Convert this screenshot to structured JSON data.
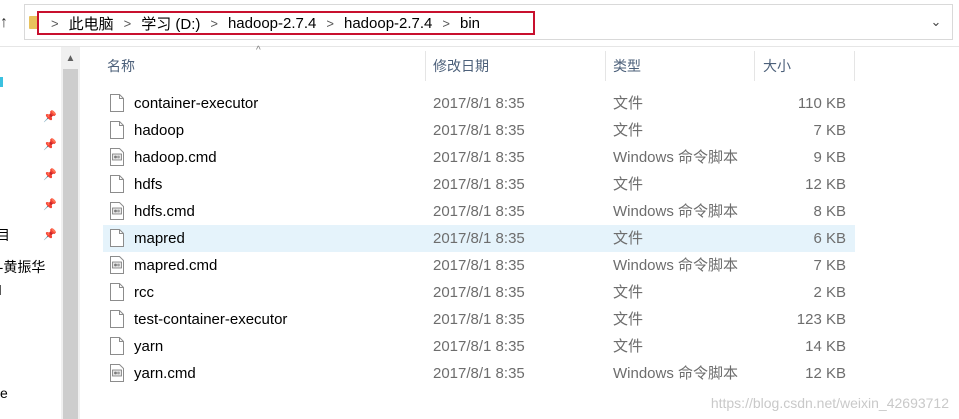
{
  "address": {
    "breadcrumbs": [
      "此电脑",
      "学习 (D:)",
      "hadoop-2.7.4",
      "hadoop-2.7.4",
      "bin"
    ]
  },
  "nav": {
    "partial_items": [
      "目",
      "--黄振华",
      "e"
    ]
  },
  "columns": {
    "name": "名称",
    "date": "修改日期",
    "type": "类型",
    "size": "大小"
  },
  "files": [
    {
      "name": "container-executor",
      "date": "2017/8/1 8:35",
      "type": "文件",
      "size": "110 KB",
      "icon": "file-icon"
    },
    {
      "name": "hadoop",
      "date": "2017/8/1 8:35",
      "type": "文件",
      "size": "7 KB",
      "icon": "file-icon"
    },
    {
      "name": "hadoop.cmd",
      "date": "2017/8/1 8:35",
      "type": "Windows 命令脚本",
      "size": "9 KB",
      "icon": "script-file-icon"
    },
    {
      "name": "hdfs",
      "date": "2017/8/1 8:35",
      "type": "文件",
      "size": "12 KB",
      "icon": "file-icon"
    },
    {
      "name": "hdfs.cmd",
      "date": "2017/8/1 8:35",
      "type": "Windows 命令脚本",
      "size": "8 KB",
      "icon": "script-file-icon"
    },
    {
      "name": "mapred",
      "date": "2017/8/1 8:35",
      "type": "文件",
      "size": "6 KB",
      "icon": "file-icon",
      "selected": true
    },
    {
      "name": "mapred.cmd",
      "date": "2017/8/1 8:35",
      "type": "Windows 命令脚本",
      "size": "7 KB",
      "icon": "script-file-icon"
    },
    {
      "name": "rcc",
      "date": "2017/8/1 8:35",
      "type": "文件",
      "size": "2 KB",
      "icon": "file-icon"
    },
    {
      "name": "test-container-executor",
      "date": "2017/8/1 8:35",
      "type": "文件",
      "size": "123 KB",
      "icon": "file-icon"
    },
    {
      "name": "yarn",
      "date": "2017/8/1 8:35",
      "type": "文件",
      "size": "14 KB",
      "icon": "file-icon"
    },
    {
      "name": "yarn.cmd",
      "date": "2017/8/1 8:35",
      "type": "Windows 命令脚本",
      "size": "12 KB",
      "icon": "script-file-icon"
    }
  ],
  "watermark": "https://blog.csdn.net/weixin_42693712",
  "colors": {
    "highlight": "#c8102e",
    "selection": "#e5f3fb",
    "header_text": "#4c607a"
  }
}
